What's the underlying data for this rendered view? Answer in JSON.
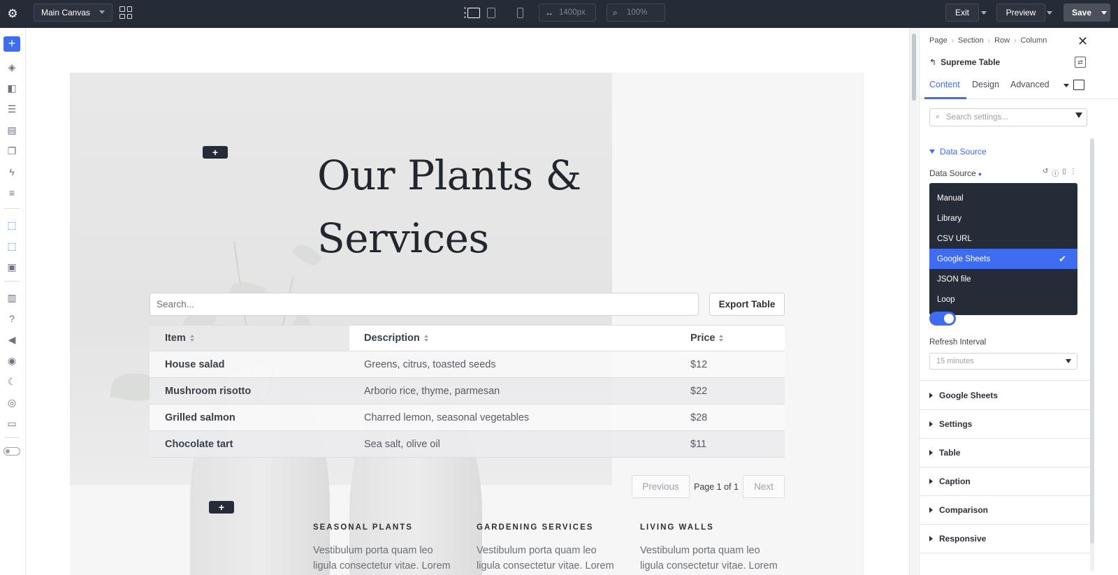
{
  "topbar": {
    "canvas_select": "Main Canvas",
    "width_value": "1400px",
    "zoom_value": "100%",
    "exit_label": "Exit",
    "preview_label": "Preview",
    "save_label": "Save"
  },
  "page": {
    "hero_title_line1": "Our Plants &",
    "hero_title_line2": "Services",
    "search_placeholder": "Search...",
    "export_label": "Export Table",
    "table": {
      "headers": [
        "Item",
        "Description",
        "Price"
      ],
      "rows": [
        [
          "House salad",
          "Greens, citrus, toasted seeds",
          "$12"
        ],
        [
          "Mushroom risotto",
          "Arborio rice, thyme, parmesan",
          "$22"
        ],
        [
          "Grilled salmon",
          "Charred lemon, seasonal vegetables",
          "$28"
        ],
        [
          "Chocolate tart",
          "Sea salt, olive oil",
          "$11"
        ]
      ]
    },
    "pager": {
      "previous": "Previous",
      "info": "Page 1 of 1",
      "next": "Next"
    },
    "columns": [
      {
        "heading": "SEASONAL PLANTS",
        "text": "Vestibulum porta quam leo ligula consectetur vitae. Lorem ipsum"
      },
      {
        "heading": "GARDENING SERVICES",
        "text": "Vestibulum porta quam leo ligula consectetur vitae. Lorem ipsum"
      },
      {
        "heading": "LIVING WALLS",
        "text": "Vestibulum porta quam leo ligula consectetur vitae. Lorem ipsum"
      }
    ]
  },
  "panel": {
    "breadcrumbs": [
      "Page",
      "Section",
      "Row",
      "Column"
    ],
    "module_title": "Supreme Table",
    "tabs": [
      "Content",
      "Design",
      "Advanced"
    ],
    "search_placeholder": "Search settings...",
    "open_group": "Data Source",
    "field_label": "Data Source",
    "options": [
      "Manual",
      "Library",
      "CSV URL",
      "Google Sheets",
      "JSON file",
      "Loop"
    ],
    "selected_option": "Google Sheets",
    "refresh_label": "Refresh Interval",
    "refresh_value": "15 minutes",
    "groups": [
      "Google Sheets",
      "Settings",
      "Table",
      "Caption",
      "Comparison",
      "Responsive"
    ]
  },
  "colors": {
    "accent": "#3f6df2",
    "topbar": "#252b37"
  }
}
